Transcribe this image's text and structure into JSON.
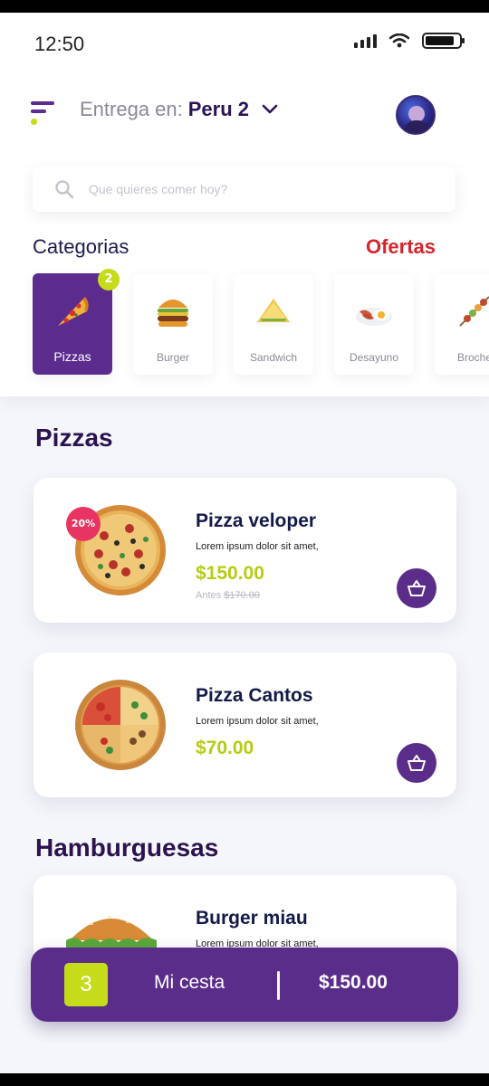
{
  "status_bar": {
    "time": "12:50",
    "battery_level": 0.85
  },
  "header": {
    "delivery_label": "Entrega en:",
    "delivery_location": "Peru 2"
  },
  "search": {
    "placeholder": "Que quieres comer hoy?"
  },
  "categories": {
    "title": "Categorias",
    "offers_label": "Ofertas",
    "items": [
      {
        "label": "Pizzas",
        "badge": "2",
        "icon": "pizza-slice-icon",
        "selected": true
      },
      {
        "label": "Burger",
        "icon": "burger-icon"
      },
      {
        "label": "Sandwich",
        "icon": "sandwich-icon"
      },
      {
        "label": "Desayuno",
        "icon": "breakfast-icon"
      },
      {
        "label": "Broche",
        "icon": "skewer-icon"
      }
    ]
  },
  "sections": [
    {
      "title": "Pizzas",
      "products": [
        {
          "name": "Pizza veloper",
          "description": "Lorem ipsum dolor sit amet,",
          "price": "$150.00",
          "old_price_label": "Antes",
          "old_price": "$170.00",
          "discount": "20%"
        },
        {
          "name": "Pizza Cantos",
          "description": "Lorem ipsum dolor sit amet,",
          "price": "$70.00"
        }
      ]
    },
    {
      "title": "Hamburguesas",
      "products": [
        {
          "name": "Burger miau",
          "description": "Lorem ipsum dolor sit amet,"
        }
      ]
    }
  ],
  "basket": {
    "count": "3",
    "label": "Mi cesta",
    "total": "$150.00"
  },
  "colors": {
    "primary": "#5a2d8a",
    "accent": "#c6db1a",
    "offers": "#d6252a",
    "discount": "#e83462"
  }
}
